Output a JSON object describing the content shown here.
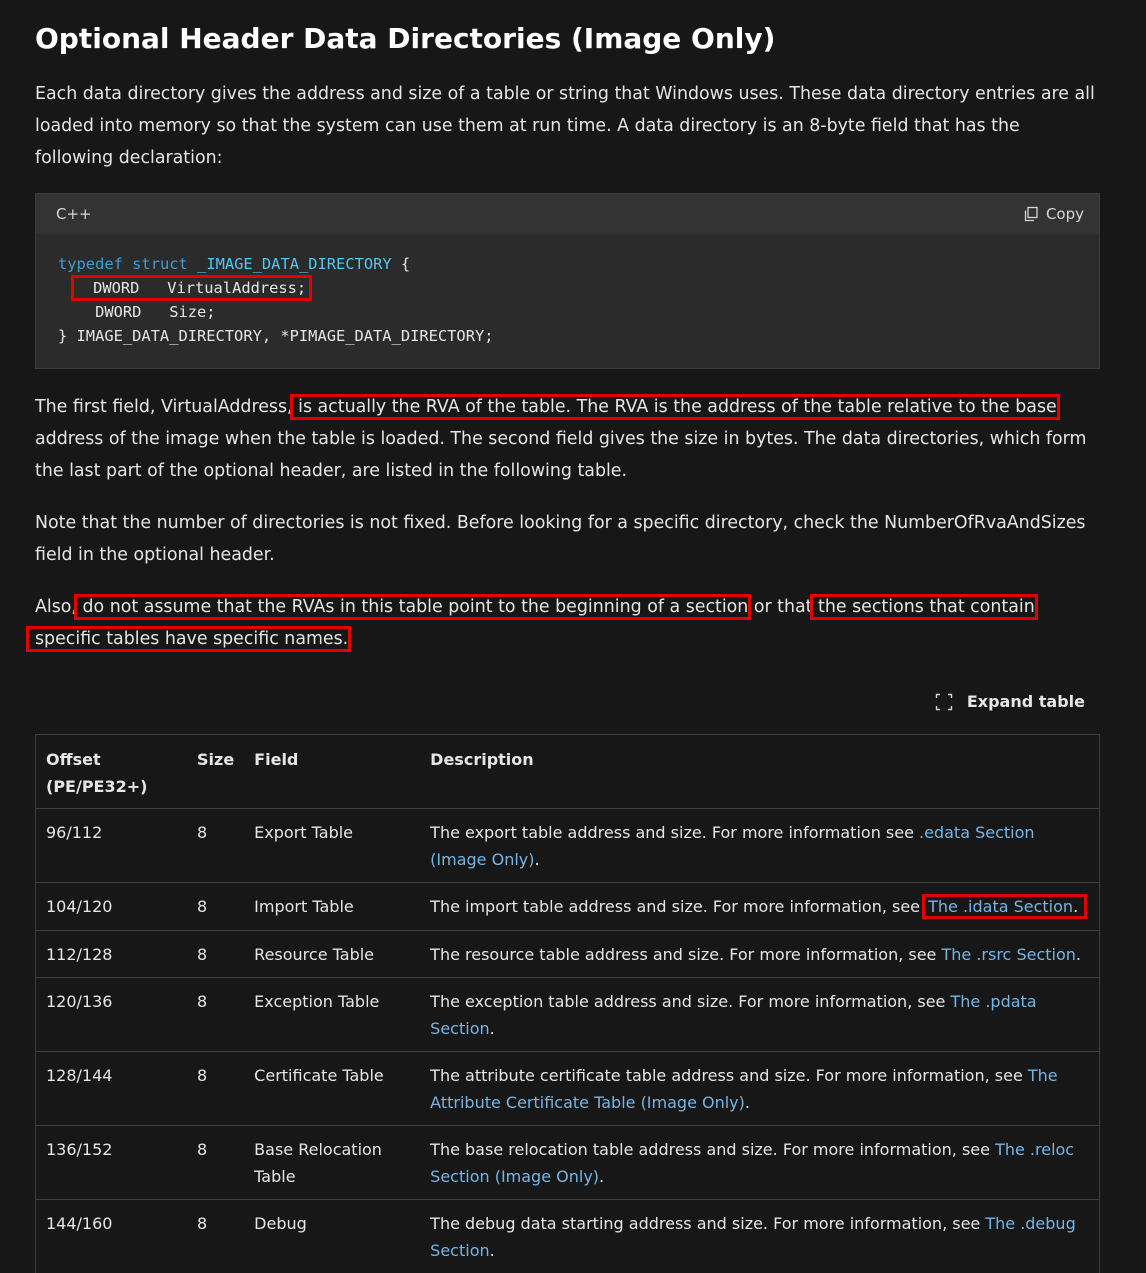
{
  "title": "Optional Header Data Directories (Image Only)",
  "intro": "Each data directory gives the address and size of a table or string that Windows uses. These data directory entries are all loaded into memory so that the system can use them at run time. A data directory is an 8-byte field that has the following declaration:",
  "code": {
    "language": "C++",
    "copy_label": "Copy",
    "line1_kw1": "typedef",
    "line1_kw2": "struct",
    "line1_type": "_IMAGE_DATA_DIRECTORY",
    "line1_rest": " {",
    "line2": "DWORD   VirtualAddress;",
    "line3": "    DWORD   Size;",
    "line4": "} IMAGE_DATA_DIRECTORY, *PIMAGE_DATA_DIRECTORY;"
  },
  "para2": {
    "pre": "The first field, VirtualAddress,",
    "hl": " is actually the RVA of the table. The RVA is the address of the table relative to the base",
    "post": " address of the image when the table is loaded. The second field gives the size in bytes. The data directories, which form the last part of the optional header, are listed in the following table."
  },
  "para3": "Note that the number of directories is not fixed. Before looking for a specific directory, check the NumberOfRvaAndSizes field in the optional header.",
  "para4": {
    "pre": "Also,",
    "hl1": " do not assume that the RVAs in this table point to the beginning of a section",
    "mid": " or that",
    "hl2a": " the sections that contain ",
    "hl2b": "specific tables have specific names."
  },
  "expand_label": "Expand table",
  "table": {
    "headers": [
      "Offset (PE/PE32+)",
      "Size",
      "Field",
      "Description"
    ],
    "rows": [
      {
        "offset": "96/112",
        "size": "8",
        "field": "Export Table",
        "desc": "The export table address and size. For more information see ",
        "link": ".edata Section (Image Only)",
        "end": "."
      },
      {
        "offset": "104/120",
        "size": "8",
        "field": "Import Table",
        "desc": "The import table address and size. For more information, see ",
        "link": "The .idata Section",
        "end": "."
      },
      {
        "offset": "112/128",
        "size": "8",
        "field": "Resource Table",
        "desc": "The resource table address and size. For more information, see ",
        "link": "The .rsrc Section",
        "end": "."
      },
      {
        "offset": "120/136",
        "size": "8",
        "field": "Exception Table",
        "desc": "The exception table address and size. For more information, see ",
        "link": "The .pdata Section",
        "end": "."
      },
      {
        "offset": "128/144",
        "size": "8",
        "field": "Certificate Table",
        "desc": "The attribute certificate table address and size. For more information, see ",
        "link": "The Attribute Certificate Table (Image Only)",
        "end": "."
      },
      {
        "offset": "136/152",
        "size": "8",
        "field": "Base Relocation Table",
        "desc": "The base relocation table address and size. For more information, see ",
        "link": "The .reloc Section (Image Only)",
        "end": "."
      },
      {
        "offset": "144/160",
        "size": "8",
        "field": "Debug",
        "desc": "The debug data starting address and size. For more information, see ",
        "link": "The .debug Section",
        "end": "."
      }
    ]
  },
  "colors": {
    "background": "#171717",
    "link": "#75b6e7",
    "highlight_box": "#e30000",
    "keyword": "#3f9cd6"
  }
}
